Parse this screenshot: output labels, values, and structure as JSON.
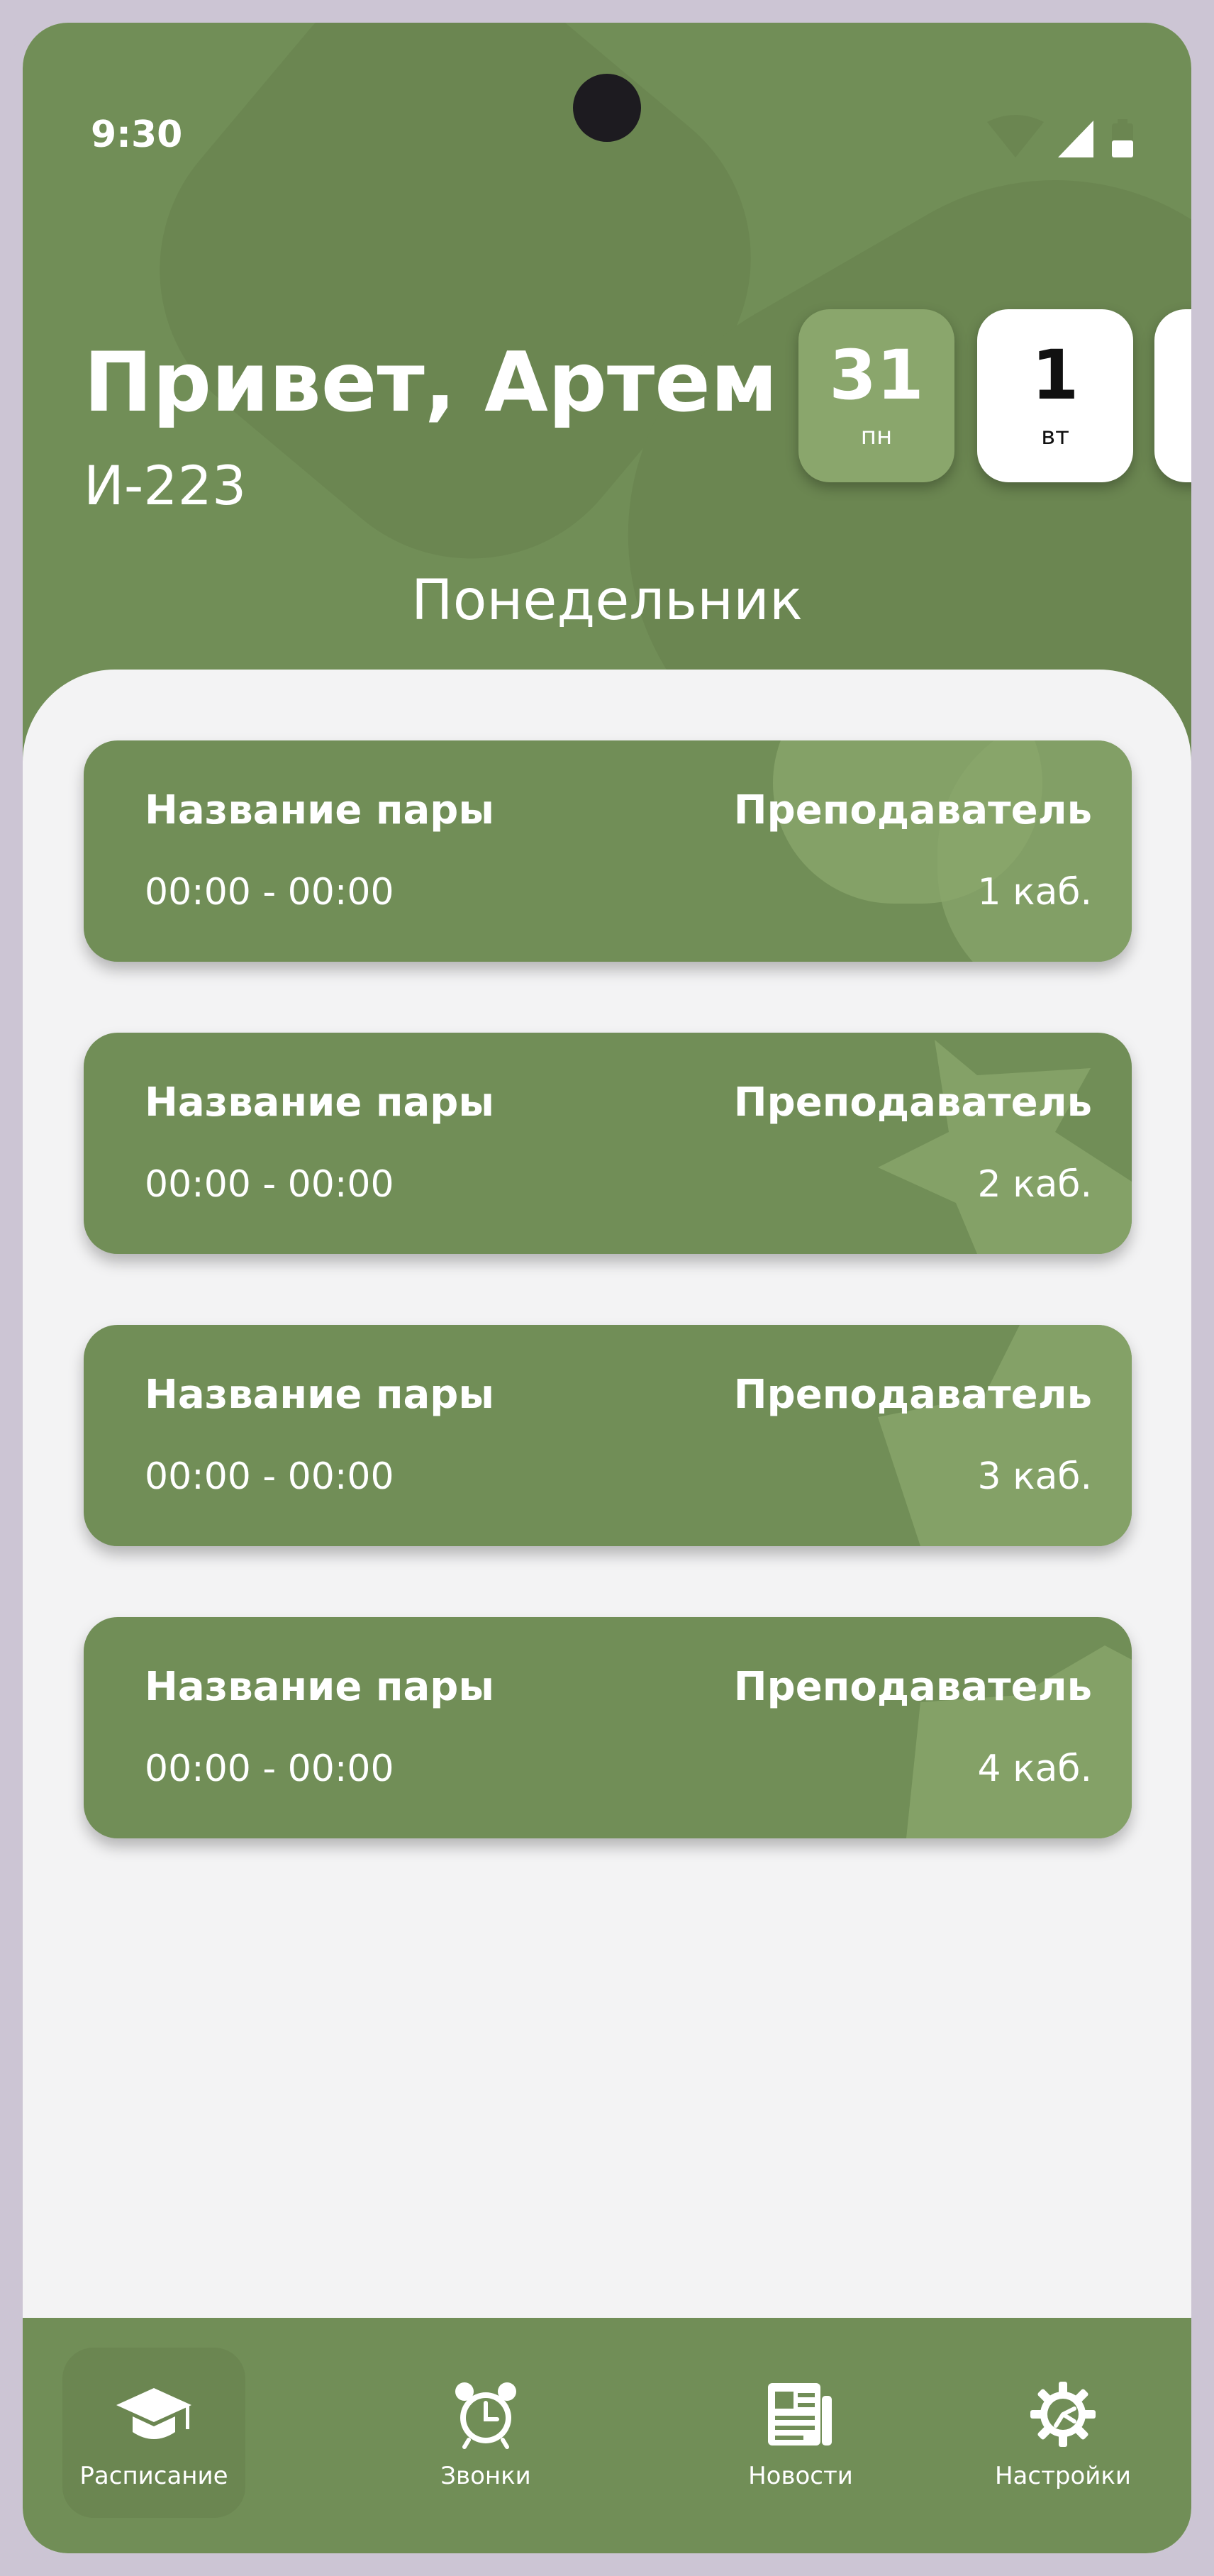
{
  "status_bar": {
    "time": "9:30"
  },
  "header": {
    "greeting": "Привет, Артем",
    "group": "И-223",
    "day_name": "Понедельник"
  },
  "dates": [
    {
      "day": "31",
      "weekday": "пн",
      "selected": true
    },
    {
      "day": "1",
      "weekday": "вт",
      "selected": false
    }
  ],
  "lessons": [
    {
      "name": "Название пары",
      "time": "00:00 - 00:00",
      "teacher": "Преподаватель",
      "room": "1 каб."
    },
    {
      "name": "Название пары",
      "time": "00:00 - 00:00",
      "teacher": "Преподаватель",
      "room": "2 каб."
    },
    {
      "name": "Название пары",
      "time": "00:00 - 00:00",
      "teacher": "Преподаватель",
      "room": "3 каб."
    },
    {
      "name": "Название пары",
      "time": "00:00 - 00:00",
      "teacher": "Преподаватель",
      "room": "4 каб."
    }
  ],
  "nav": [
    {
      "label": "Расписание",
      "icon": "graduation-cap-icon",
      "active": true
    },
    {
      "label": "Звонки",
      "icon": "alarm-clock-icon",
      "active": false
    },
    {
      "label": "Новости",
      "icon": "newspaper-icon",
      "active": false
    },
    {
      "label": "Настройки",
      "icon": "gear-icon",
      "active": false
    }
  ],
  "colors": {
    "primary": "#718e57",
    "accent": "#8aa66c",
    "background": "#f3f3f4",
    "frame": "#ccc5d4"
  }
}
